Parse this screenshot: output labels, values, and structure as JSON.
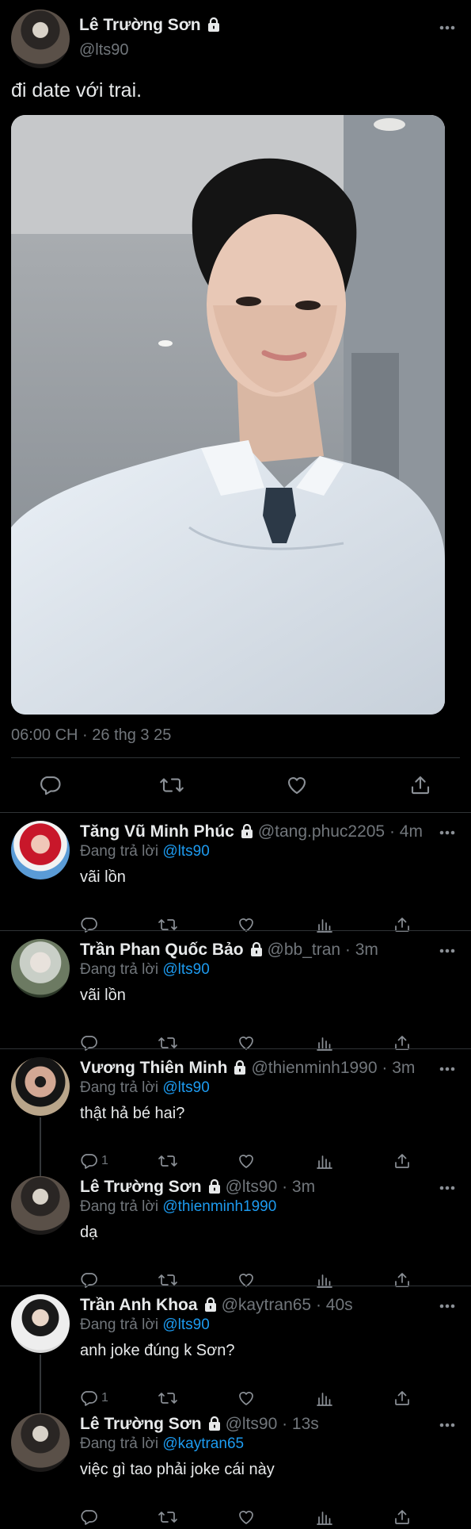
{
  "main_tweet": {
    "author_name": "Lê Trường Sơn",
    "author_handle": "@lts90",
    "text": "đi date với trai.",
    "timestamp": "06:00 CH · 26 thg 3 25",
    "icons": [
      "lock-icon",
      "more-icon",
      "reply-icon",
      "retweet-icon",
      "like-icon",
      "share-icon"
    ]
  },
  "replies": [
    {
      "name": "Tăng Vũ Minh Phúc",
      "meta": "@tang.phuc2205 · 4m",
      "replying_prefix": "Đang trả lời ",
      "replying_to": "@lts90",
      "text": "vãi lồn",
      "reply_count": ""
    },
    {
      "name": "Trần Phan Quốc Bảo",
      "meta": "@bb_tran · 3m",
      "replying_prefix": "Đang trả lời ",
      "replying_to": "@lts90",
      "text": "vãi lồn",
      "reply_count": ""
    },
    {
      "name": "Vương Thiên Minh",
      "meta": "@thienminh1990 · 3m",
      "replying_prefix": "Đang trả lời ",
      "replying_to": "@lts90",
      "text": "thật hả bé hai?",
      "reply_count": "1"
    },
    {
      "name": "Lê Trường Sơn",
      "meta": "@lts90 · 3m",
      "replying_prefix": "Đang trả lời ",
      "replying_to": "@thienminh1990",
      "text": "dạ",
      "reply_count": ""
    },
    {
      "name": "Trần Anh Khoa",
      "meta": "@kaytran65 · 40s",
      "replying_prefix": "Đang trả lời ",
      "replying_to": "@lts90",
      "text": "anh joke đúng k Sơn?",
      "reply_count": "1"
    },
    {
      "name": "Lê Trường Sơn",
      "meta": "@lts90 · 13s",
      "replying_prefix": "Đang trả lời ",
      "replying_to": "@kaytran65",
      "text": "việc gì tao phải joke cái này",
      "reply_count": ""
    }
  ],
  "colors": {
    "background": "#000000",
    "text": "#e7e9ea",
    "secondary": "#71767b",
    "link": "#1d9bf0",
    "divider": "#2f3336"
  }
}
